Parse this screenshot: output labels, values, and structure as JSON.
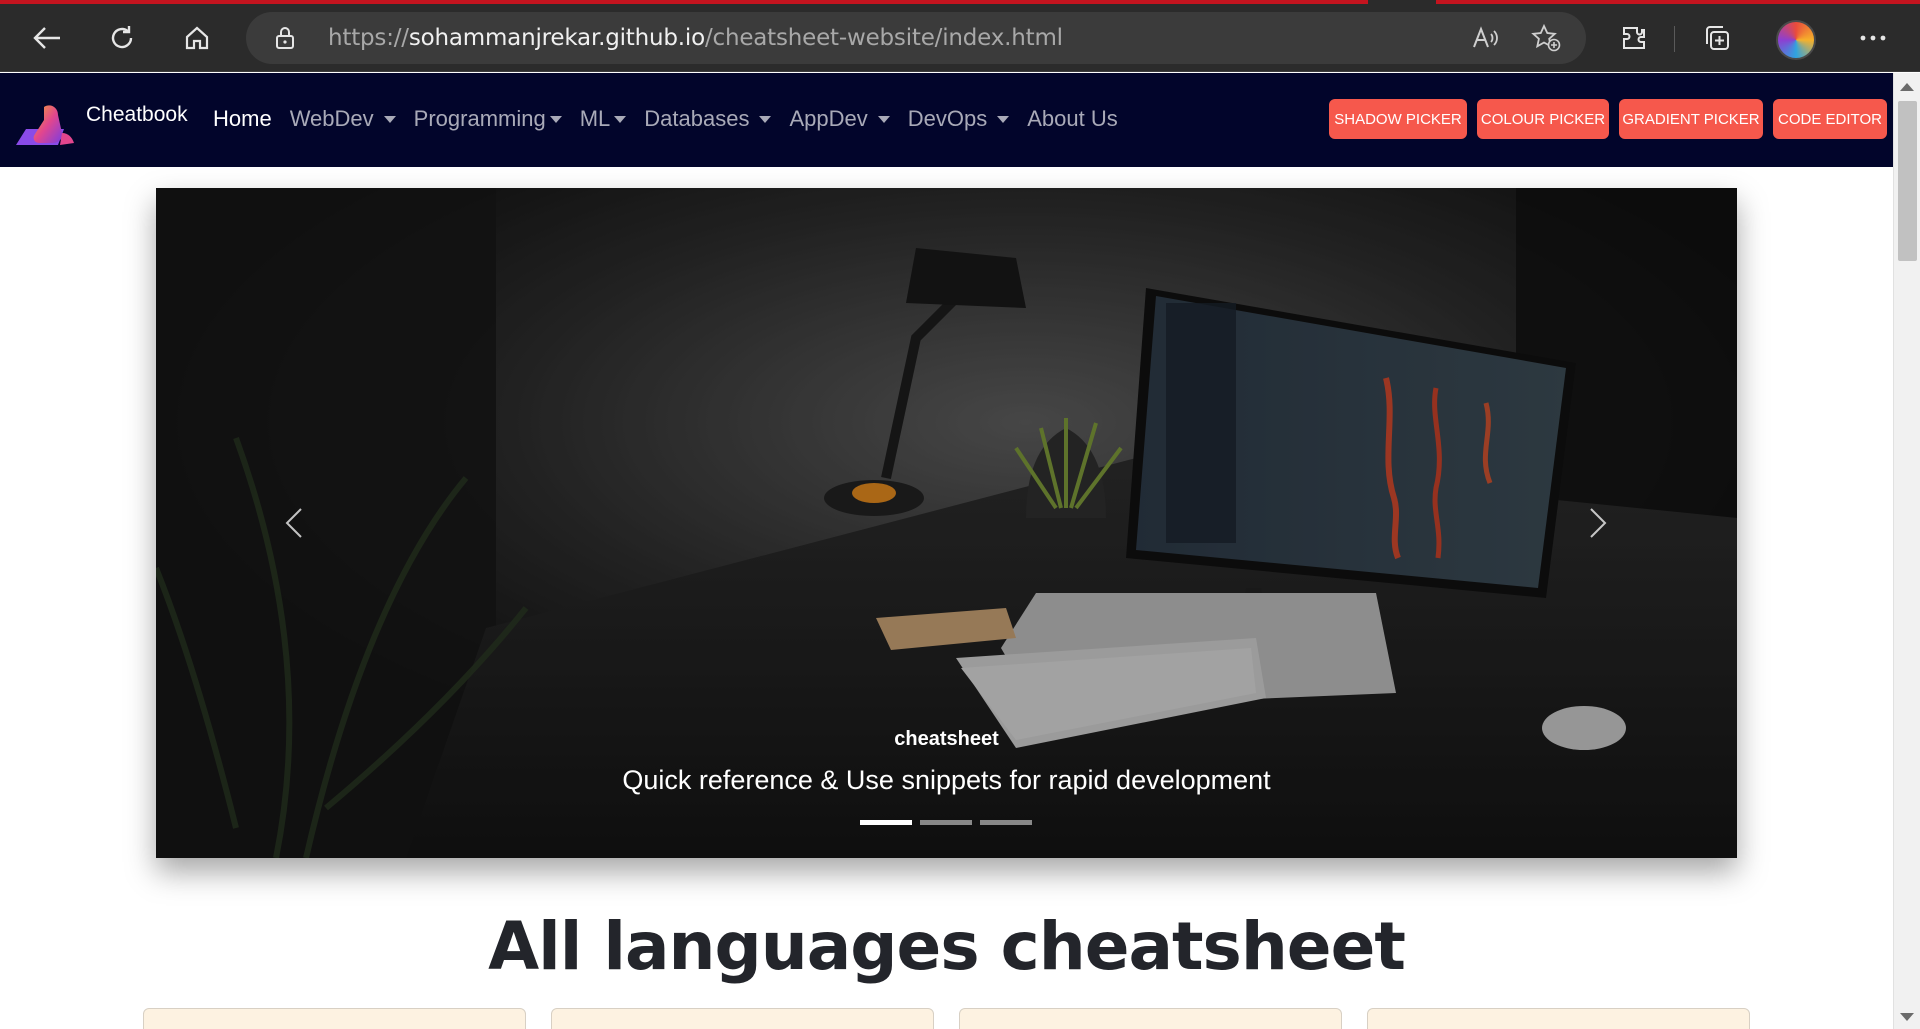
{
  "browser": {
    "url_prefix": "https://",
    "url_host": "sohammanjrekar.github.io",
    "url_path": "/cheatsheet-website/index.html",
    "icons": [
      "back-icon",
      "refresh-icon",
      "home-icon",
      "site-info-icon",
      "read-aloud-icon",
      "favorites-icon",
      "extensions-icon",
      "collections-icon",
      "profile-avatar",
      "more-icon"
    ]
  },
  "site": {
    "brand": "Cheatbook",
    "nav": [
      {
        "label": "Home",
        "dropdown": false,
        "active": true
      },
      {
        "label": "WebDev",
        "dropdown": true
      },
      {
        "label": "Programming",
        "dropdown": true
      },
      {
        "label": "ML",
        "dropdown": true
      },
      {
        "label": "Databases",
        "dropdown": true
      },
      {
        "label": "AppDev",
        "dropdown": true
      },
      {
        "label": "DevOps",
        "dropdown": true
      },
      {
        "label": "About Us",
        "dropdown": false
      }
    ],
    "tools": [
      "SHADOW PICKER",
      "COLOUR PICKER",
      "GRADIENT PICKER",
      "CODE EDITOR"
    ],
    "colors": {
      "navbar": "#02052b",
      "tool_button": "#f6584c"
    }
  },
  "carousel": {
    "caption_title": "cheatsheet",
    "caption_text": "Quick reference & Use snippets for rapid development",
    "slides": 3,
    "active_slide": 1
  },
  "main": {
    "heading": "All languages cheatsheet"
  }
}
